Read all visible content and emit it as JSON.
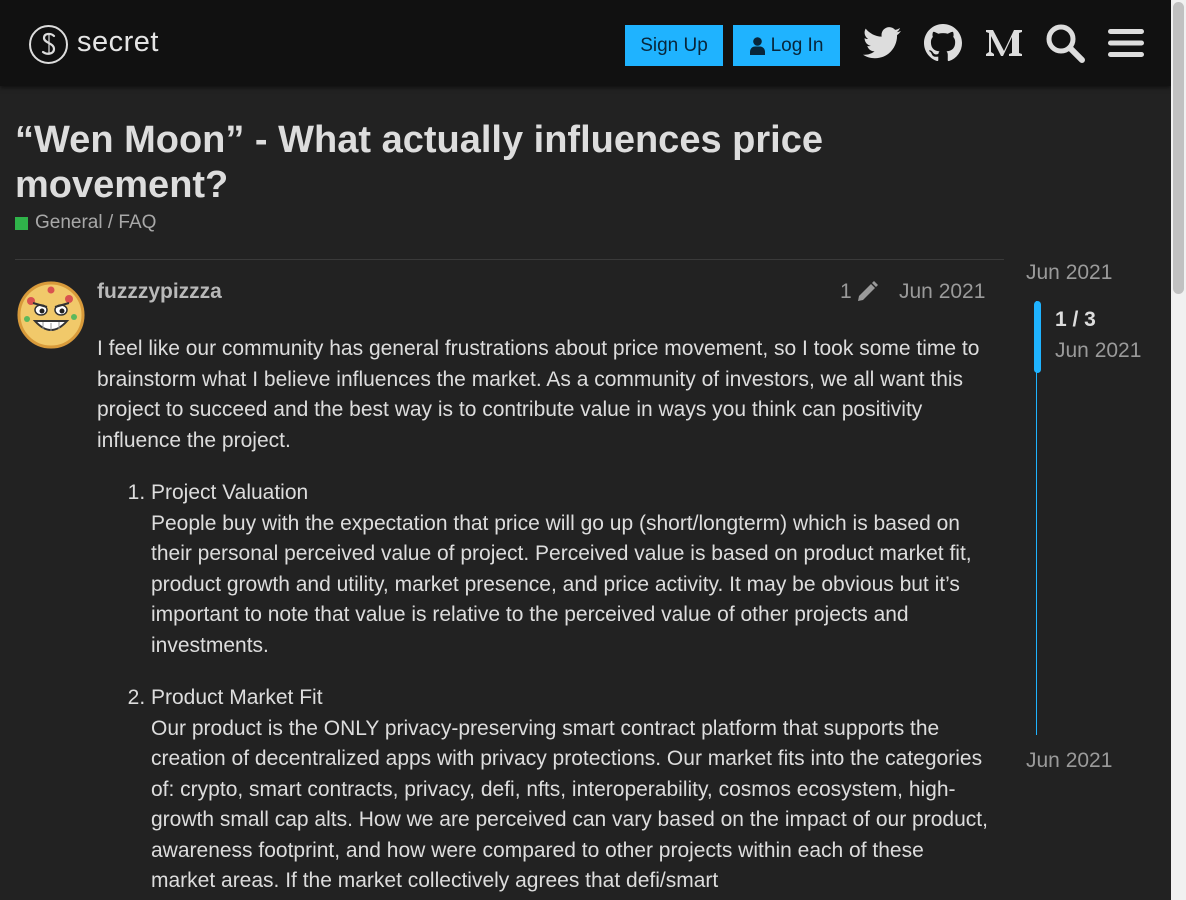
{
  "header": {
    "logo_text": "secret",
    "signup_label": "Sign Up",
    "login_label": "Log In",
    "icons": [
      "twitter-icon",
      "github-icon",
      "medium-icon",
      "search-icon",
      "menu-icon"
    ]
  },
  "topic": {
    "title": "“Wen Moon” - What actually influences price movement?",
    "category": "General / FAQ",
    "category_color": "#2fb34a"
  },
  "post": {
    "username": "fuzzzypizzza",
    "edit_count": "1",
    "date": "Jun 2021",
    "intro": "I feel like our community has general frustrations about price movement, so I took some time to brainstorm what I believe influences the market. As a community of investors, we all want this project to succeed and the best way is to contribute value in ways you think can positivity influence the project.",
    "items": [
      {
        "heading": "Project Valuation",
        "text": "People buy with the expectation that price will go up (short/longterm) which is based on their personal perceived value of project. Perceived value is based on product market fit, product growth and utility, market presence, and price activity. It may be obvious but it’s important to note that value is relative to the perceived value of other projects and investments."
      },
      {
        "heading": "Product Market Fit",
        "text": "Our product is the ONLY privacy-preserving smart contract platform that supports the creation of decentralized apps with privacy protections. Our market fits into the categories of: crypto, smart contracts, privacy, defi, nfts, interoperability, cosmos ecosystem, high-growth small cap alts. How we are perceived can vary based on the impact of our product, awareness footprint, and how were compared to other projects within each of these market areas. If the market collectively agrees that defi/smart"
      }
    ]
  },
  "timeline": {
    "start_date": "Jun 2021",
    "position": "1 / 3",
    "current_date": "Jun 2021",
    "end_date": "Jun 2021"
  },
  "colors": {
    "accent": "#1fb3ff",
    "background": "#222222",
    "header_bg": "#111111"
  }
}
